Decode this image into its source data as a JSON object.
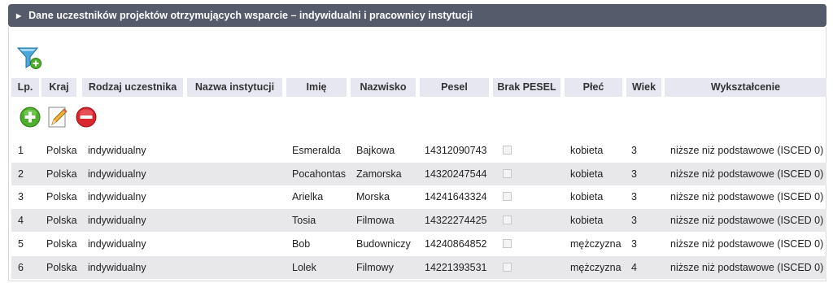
{
  "panel": {
    "title": "Dane uczestników projektów otrzymujących wsparcie – indywidualni i pracownicy instytucji"
  },
  "toolbar": {
    "filter_icon": "filter-add-icon"
  },
  "columns": [
    "Lp.",
    "Kraj",
    "Rodzaj uczestnika",
    "Nazwa instytucji",
    "Imię",
    "Nazwisko",
    "Pesel",
    "Brak PESEL",
    "Płeć",
    "Wiek",
    "Wykształcenie"
  ],
  "actions": {
    "add_icon": "add-icon",
    "edit_icon": "edit-icon",
    "delete_icon": "delete-icon"
  },
  "rows": [
    {
      "lp": "1",
      "kraj": "Polska",
      "rodzaj": "indywidualny",
      "nazwa": "",
      "imie": "Esmeralda",
      "nazwisko": "Bajkowa",
      "pesel": "14312090743",
      "brak_pesel": false,
      "plec": "kobieta",
      "wiek": "3",
      "wyksztalcenie": "niższe niż podstawowe (ISCED 0)"
    },
    {
      "lp": "2",
      "kraj": "Polska",
      "rodzaj": "indywidualny",
      "nazwa": "",
      "imie": "Pocahontas",
      "nazwisko": "Zamorska",
      "pesel": "14320247544",
      "brak_pesel": false,
      "plec": "kobieta",
      "wiek": "3",
      "wyksztalcenie": "niższe niż podstawowe (ISCED 0)"
    },
    {
      "lp": "3",
      "kraj": "Polska",
      "rodzaj": "indywidualny",
      "nazwa": "",
      "imie": "Arielka",
      "nazwisko": "Morska",
      "pesel": "14241643324",
      "brak_pesel": false,
      "plec": "kobieta",
      "wiek": "3",
      "wyksztalcenie": "niższe niż podstawowe (ISCED 0)"
    },
    {
      "lp": "4",
      "kraj": "Polska",
      "rodzaj": "indywidualny",
      "nazwa": "",
      "imie": "Tosia",
      "nazwisko": "Filmowa",
      "pesel": "14322274425",
      "brak_pesel": false,
      "plec": "kobieta",
      "wiek": "3",
      "wyksztalcenie": "niższe niż podstawowe (ISCED 0)"
    },
    {
      "lp": "5",
      "kraj": "Polska",
      "rodzaj": "indywidualny",
      "nazwa": "",
      "imie": "Bob",
      "nazwisko": "Budowniczy",
      "pesel": "14240864852",
      "brak_pesel": false,
      "plec": "mężczyzna",
      "wiek": "3",
      "wyksztalcenie": "niższe niż podstawowe (ISCED 0)"
    },
    {
      "lp": "6",
      "kraj": "Polska",
      "rodzaj": "indywidualny",
      "nazwa": "",
      "imie": "Lolek",
      "nazwisko": "Filmowy",
      "pesel": "14221393531",
      "brak_pesel": false,
      "plec": "mężczyzna",
      "wiek": "4",
      "wyksztalcenie": "niższe niż podstawowe (ISCED 0)"
    }
  ]
}
